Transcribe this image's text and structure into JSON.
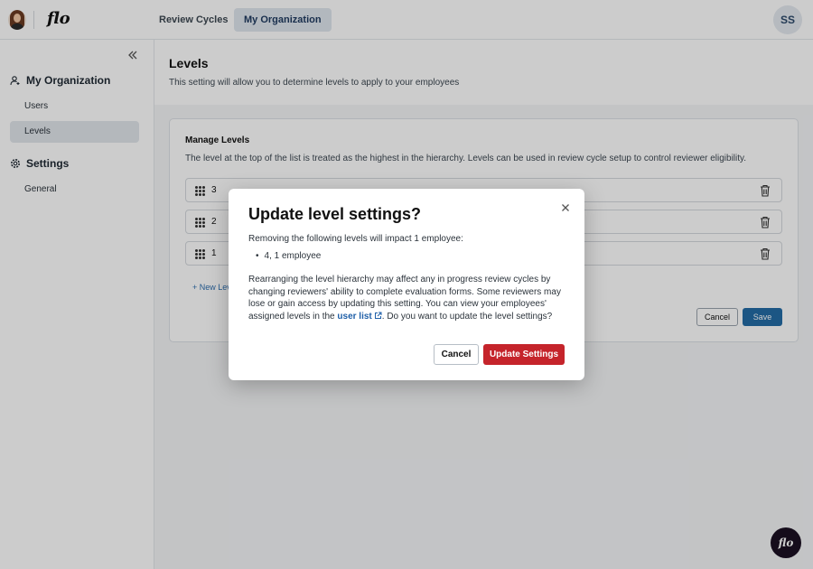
{
  "topbar": {
    "logo": "flo",
    "tabs": [
      {
        "label": "Review Cycles",
        "active": false
      },
      {
        "label": "My Organization",
        "active": true
      }
    ],
    "user_initials": "SS"
  },
  "sidebar": {
    "sections": [
      {
        "title": "My Organization",
        "icon": "user-icon",
        "items": [
          {
            "label": "Users",
            "active": false
          },
          {
            "label": "Levels",
            "active": true
          }
        ]
      },
      {
        "title": "Settings",
        "icon": "gear-icon",
        "items": [
          {
            "label": "General",
            "active": false
          }
        ]
      }
    ]
  },
  "page": {
    "title": "Levels",
    "subtitle": "This setting will allow you to determine levels to apply to your employees"
  },
  "card": {
    "title": "Manage Levels",
    "description": "The level at the top of the list is treated as the highest in the hierarchy. Levels can be used in review cycle setup to control reviewer eligibility.",
    "levels": [
      "3",
      "2",
      "1"
    ],
    "new_level_label": "+ New Level",
    "cancel_label": "Cancel",
    "save_label": "Save"
  },
  "modal": {
    "title": "Update level settings?",
    "impact_line": "Removing the following levels will impact 1 employee:",
    "bullet": "4, 1 employee",
    "para_before": "Rearranging the level hierarchy may affect any in progress review cycles by changing reviewers' ability to complete evaluation forms. Some reviewers may lose or gain access by updating this setting. You can view your employees' assigned levels in the ",
    "link_text": "user list",
    "para_after": ". Do you want to update the level settings?",
    "cancel_label": "Cancel",
    "confirm_label": "Update Settings"
  },
  "fab": {
    "label": "flo"
  },
  "colors": {
    "primary": "#236ca6",
    "danger": "#c5242b",
    "link": "#1f5fa8",
    "active_nav": "#e1e6ec"
  }
}
